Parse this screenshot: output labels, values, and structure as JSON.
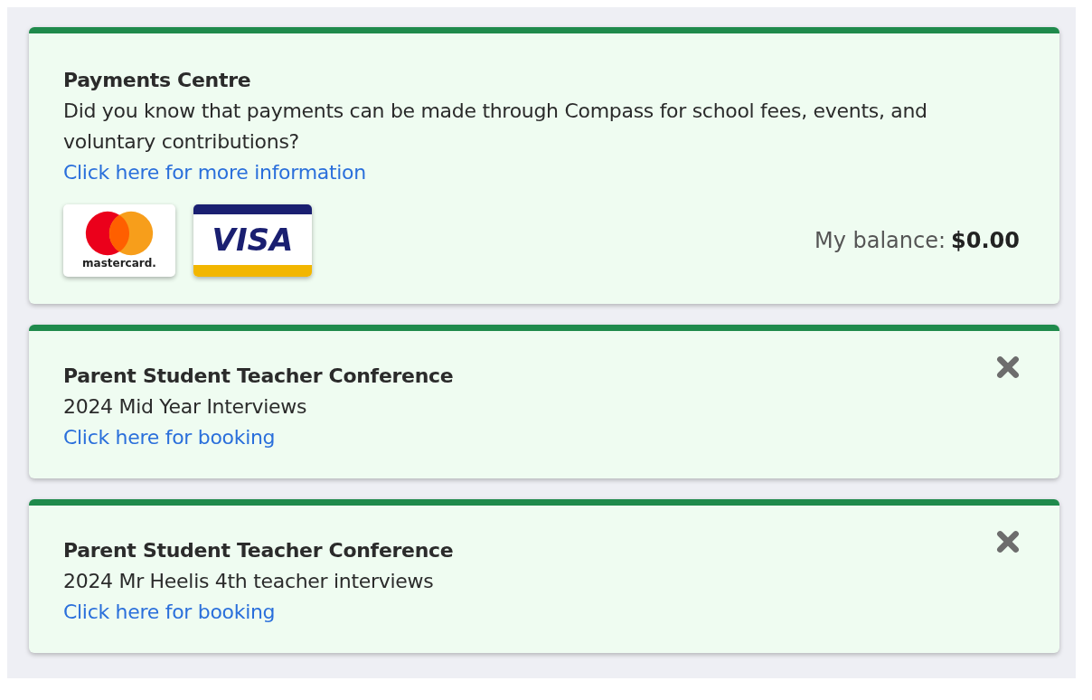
{
  "cards": [
    {
      "kind": "payment",
      "title": "Payments Centre",
      "text": "Did you know that payments can be made through Compass for school fees, events, and voluntary contributions?",
      "link": "Click here for more information",
      "dismissible": false,
      "logos": [
        {
          "kind": "mastercard",
          "text": "mastercard."
        },
        {
          "kind": "visa",
          "text": "VISA"
        }
      ],
      "balance_label": "My balance:",
      "balance_value": "$0.00"
    },
    {
      "kind": "booking",
      "title": "Parent Student Teacher Conference",
      "text": "2024 Mid Year Interviews",
      "link": "Click here for booking",
      "dismissible": true
    },
    {
      "kind": "booking",
      "title": "Parent Student Teacher Conference",
      "text": "2024 Mr Heelis 4th teacher interviews",
      "link": "Click here for booking",
      "dismissible": true
    }
  ]
}
